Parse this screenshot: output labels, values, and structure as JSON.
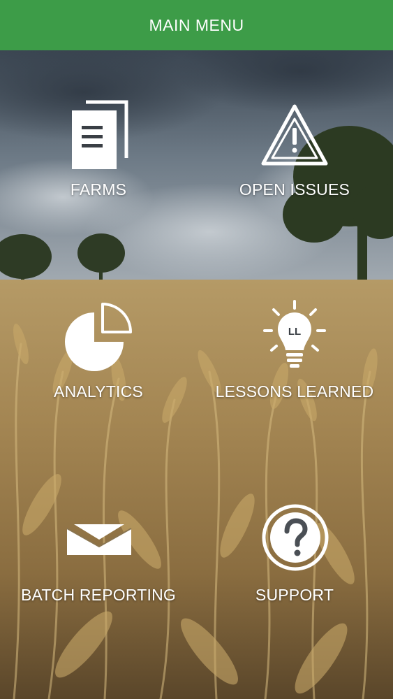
{
  "header": {
    "title": "MAIN MENU"
  },
  "menu": {
    "items": [
      {
        "label": "FARMS",
        "icon": "document-icon"
      },
      {
        "label": "OPEN ISSUES",
        "icon": "warning-icon"
      },
      {
        "label": "ANALYTICS",
        "icon": "pie-chart-icon"
      },
      {
        "label": "LESSONS LEARNED",
        "icon": "lightbulb-icon"
      },
      {
        "label": "BATCH REPORTING",
        "icon": "envelope-icon"
      },
      {
        "label": "SUPPORT",
        "icon": "help-icon"
      }
    ]
  },
  "colors": {
    "header_bg": "#3d9c48",
    "text": "#ffffff"
  }
}
